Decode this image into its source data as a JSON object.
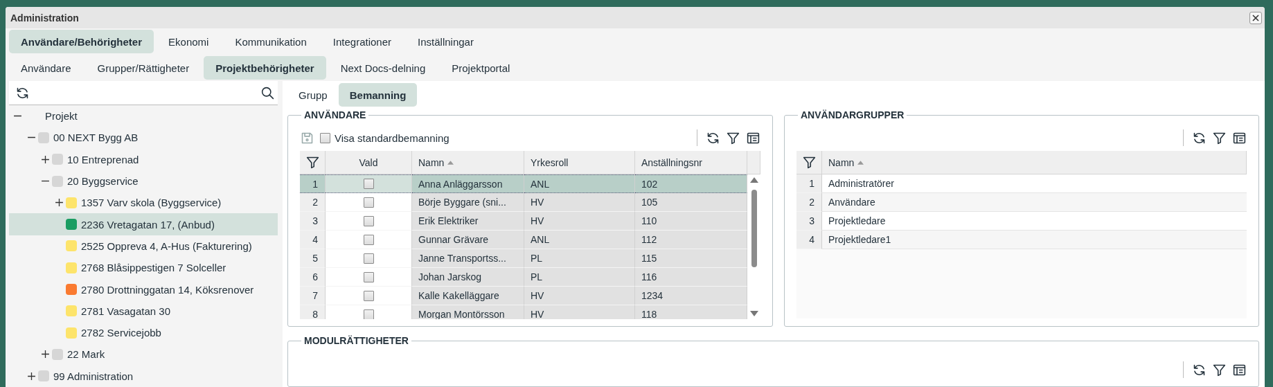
{
  "window": {
    "title": "Administration"
  },
  "main_tabs": [
    {
      "label": "Användare/Behörigheter",
      "selected": true
    },
    {
      "label": "Ekonomi",
      "selected": false
    },
    {
      "label": "Kommunikation",
      "selected": false
    },
    {
      "label": "Integrationer",
      "selected": false
    },
    {
      "label": "Inställningar",
      "selected": false
    }
  ],
  "sub_tabs": [
    {
      "label": "Användare",
      "selected": false
    },
    {
      "label": "Grupper/Rättigheter",
      "selected": false
    },
    {
      "label": "Projektbehörigheter",
      "selected": true
    },
    {
      "label": "Next Docs-delning",
      "selected": false
    },
    {
      "label": "Projektportal",
      "selected": false
    }
  ],
  "tree": {
    "label": "Projekt",
    "expanded": true,
    "selected": false,
    "children": [
      {
        "label": "00 NEXT Bygg AB",
        "color": "#d6d6d6",
        "expanded": true,
        "selected": false,
        "children": [
          {
            "label": "10 Entreprenad",
            "color": "#d6d6d6",
            "expanded": false,
            "selected": false
          },
          {
            "label": "20 Byggservice",
            "color": "#d6d6d6",
            "expanded": true,
            "selected": false,
            "children": [
              {
                "label": "1357 Varv skola (Byggservice)",
                "color": "#fde46b",
                "expanded": false,
                "selected": false
              },
              {
                "label": "2236 Vretagatan 17, (Anbud)",
                "color": "#1a9d62",
                "selected": true
              },
              {
                "label": "2525 Oppreva 4, A-Hus (Fakturering)",
                "color": "#fde46b",
                "selected": false
              },
              {
                "label": "2768 Blåsippestigen 7 Solceller",
                "color": "#fde46b",
                "selected": false
              },
              {
                "label": "2780 Drottninggatan 14, Köksrenover",
                "color": "#fa7a30",
                "selected": false
              },
              {
                "label": "2781 Vasagatan 30",
                "color": "#fde46b",
                "selected": false
              },
              {
                "label": "2782 Servicejobb",
                "color": "#fde46b",
                "selected": false
              }
            ]
          },
          {
            "label": "22 Mark",
            "color": "#d6d6d6",
            "expanded": false,
            "selected": false
          }
        ]
      },
      {
        "label": "99 Administration",
        "color": "#d6d6d6",
        "expanded": false,
        "selected": false
      }
    ]
  },
  "view_tabs": [
    {
      "label": "Grupp",
      "selected": false
    },
    {
      "label": "Bemanning",
      "selected": true
    }
  ],
  "users_panel": {
    "title": "ANVÄNDARE",
    "show_default": {
      "label": "Visa standardbemanning",
      "checked": false
    },
    "columns": [
      {
        "label": "Vald",
        "sorted": false
      },
      {
        "label": "Namn",
        "sorted": true
      },
      {
        "label": "Yrkesroll",
        "sorted": false
      },
      {
        "label": "Anställningsnr",
        "sorted": false
      }
    ],
    "rows": [
      {
        "number": "1",
        "checked": false,
        "name": "Anna Anläggarsson",
        "role": "ANL",
        "employee_no": "102",
        "selected": true
      },
      {
        "number": "2",
        "checked": false,
        "name": "Börje Byggare (sni...",
        "role": "HV",
        "employee_no": "105",
        "selected": false
      },
      {
        "number": "3",
        "checked": false,
        "name": "Erik Elektriker",
        "role": "HV",
        "employee_no": "110",
        "selected": false
      },
      {
        "number": "4",
        "checked": false,
        "name": "Gunnar Grävare",
        "role": "ANL",
        "employee_no": "112",
        "selected": false
      },
      {
        "number": "5",
        "checked": false,
        "name": "Janne Transportss...",
        "role": "PL",
        "employee_no": "115",
        "selected": false
      },
      {
        "number": "6",
        "checked": false,
        "name": "Johan Jarskog",
        "role": "PL",
        "employee_no": "116",
        "selected": false
      },
      {
        "number": "7",
        "checked": false,
        "name": "Kalle Kakelläggare",
        "role": "HV",
        "employee_no": "1234",
        "selected": false
      },
      {
        "number": "8",
        "checked": false,
        "name": "Morgan Montörsson",
        "role": "HV",
        "employee_no": "118",
        "selected": false
      }
    ]
  },
  "groups_panel": {
    "title": "ANVÄNDARGRUPPER",
    "columns": [
      {
        "label": "Namn",
        "sorted": true
      }
    ],
    "rows": [
      {
        "number": "1",
        "name": "Administratörer"
      },
      {
        "number": "2",
        "name": "Användare"
      },
      {
        "number": "3",
        "name": "Projektledare"
      },
      {
        "number": "4",
        "name": "Projektledare1"
      }
    ]
  },
  "module_panel": {
    "title": "MODULRÄTTIGHETER"
  }
}
